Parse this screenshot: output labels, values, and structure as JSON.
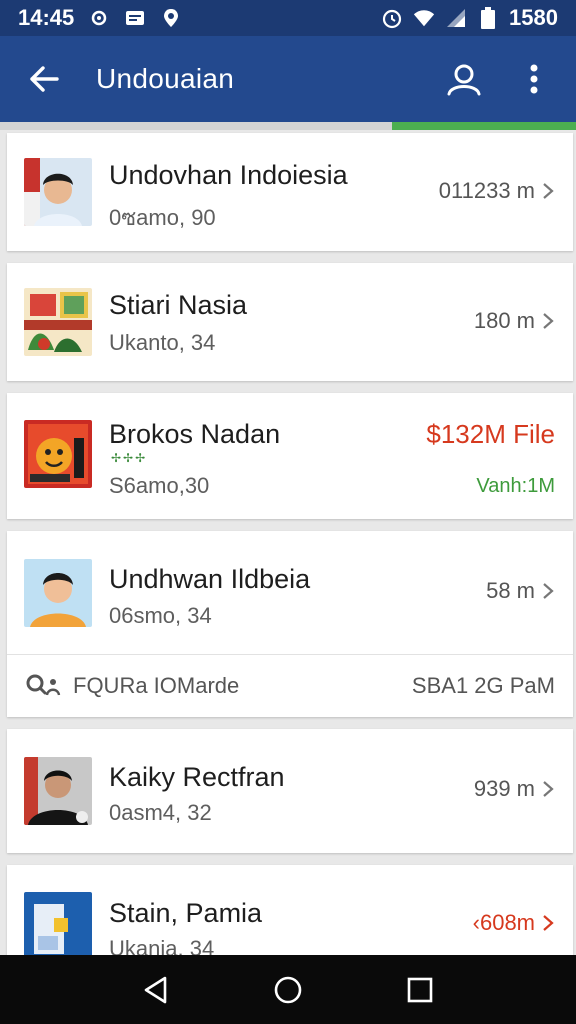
{
  "status_bar": {
    "time": "14:45",
    "battery": "1580",
    "icons": [
      "settings-icon",
      "message-icon",
      "location-icon",
      "alarm-icon",
      "wifi-icon",
      "signal-icon",
      "battery-icon"
    ]
  },
  "app_bar": {
    "title": "Undouaian",
    "back_icon": "arrow-left-icon",
    "actions": [
      "person-icon",
      "more-vertical-icon"
    ]
  },
  "progress": {
    "value": 0.32,
    "color": "#4caf50"
  },
  "items": [
    {
      "name": "Undovhan Indoiesia",
      "subtitle": "0ซamo, 90",
      "meta": "011233 m"
    },
    {
      "name": "Stiari Nasia",
      "subtitle": "Ukanto, 34",
      "meta": "180 m"
    },
    {
      "name": "Brokos Nadan",
      "subtitle": "S6amo,30",
      "meta": "$132M File",
      "meta2": "Vanh:1M",
      "marks": "✢✢✢"
    },
    {
      "name": "Undhwan Ildbeia",
      "subtitle": "06smo, 34",
      "meta": "58 m"
    },
    {
      "name": "Kaiky Rectfran",
      "subtitle": "0asm4, 32",
      "meta": "939 m"
    },
    {
      "name": "Stain, Pamia",
      "subtitle": "Ukania, 34",
      "meta": "‹608m"
    }
  ],
  "filter_row": {
    "label": "FQURa IOMarde",
    "right": "SBA1 2G PaM",
    "icon": "search-person-icon"
  },
  "nav": [
    "back-triangle-icon",
    "home-circle-icon",
    "recents-square-icon"
  ],
  "colors": {
    "status_bar": "#1c3a73",
    "app_bar": "#23498e",
    "accent_red": "#d6391e",
    "accent_green": "#3e9b3c"
  }
}
